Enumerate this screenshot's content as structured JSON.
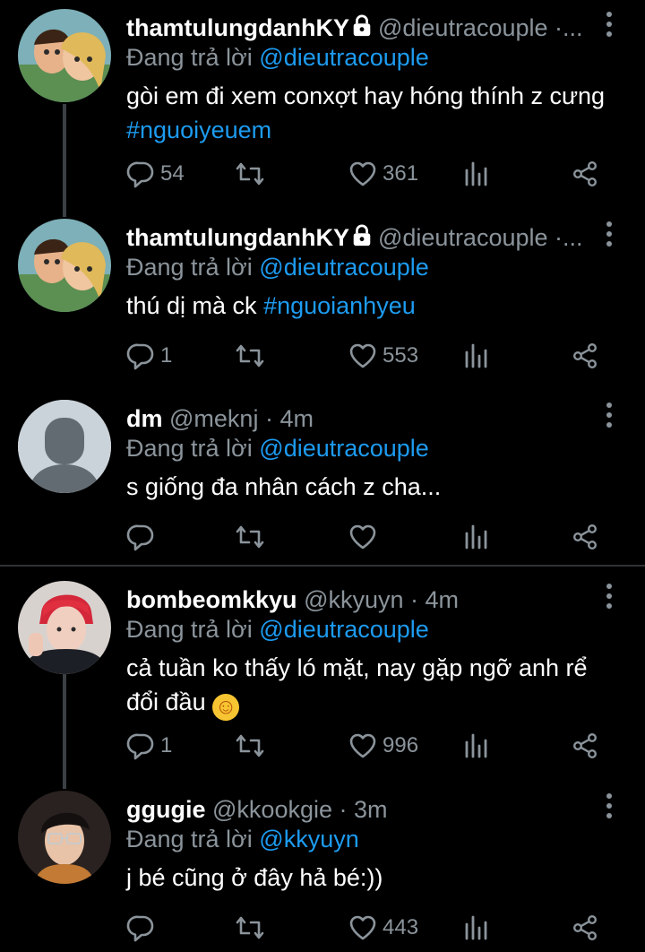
{
  "replying_prefix": "Đang trả lời",
  "tweets": [
    {
      "name": "thamtulungdanhKY",
      "locked": true,
      "handle": "@dieutracouple ·...",
      "replying_to": "@dieutracouple",
      "text_main": "gòi em đi xem conxợt hay hóng thính z cưng",
      "hashtag": "#nguoiyeuem",
      "replies": "54",
      "retweets": "",
      "likes": "361",
      "avatar": "cartoon-couple"
    },
    {
      "name": "thamtulungdanhKY",
      "locked": true,
      "handle": "@dieutracouple ·...",
      "replying_to": "@dieutracouple",
      "text_main": "thú dị mà ck ",
      "hashtag": "#nguoianhyeu",
      "replies": "1",
      "retweets": "",
      "likes": "553",
      "avatar": "cartoon-couple"
    },
    {
      "name": "dm",
      "locked": false,
      "handle": "@meknj · 4m",
      "replying_to": "@dieutracouple",
      "text_main": "s giống đa nhân cách z cha...",
      "hashtag": "",
      "replies": "",
      "retweets": "",
      "likes": "",
      "avatar": "default-user"
    },
    {
      "name": "bombeomkkyu",
      "locked": false,
      "handle": "@kkyuyn · 4m",
      "replying_to": "@dieutracouple",
      "text_line1": "cả tuần ko thấy ló mặt, nay gặp ngỡ anh rể",
      "text_line2": "đổi đầu",
      "emoji": "☺",
      "replies": "1",
      "retweets": "",
      "likes": "996",
      "avatar": "red-hair-person"
    },
    {
      "name": "ggugie",
      "locked": false,
      "handle": "@kkookgie · 3m",
      "replying_to": "@kkyuyn",
      "text_main": "j bé cũng ở đây hả bé:))",
      "hashtag": "",
      "replies": "",
      "retweets": "",
      "likes": "443",
      "avatar": "glasses-person"
    }
  ],
  "colors": {
    "background": "#000000",
    "mention": "#1d9bf0",
    "muted": "#8b949b",
    "divider": "#2f3336"
  }
}
